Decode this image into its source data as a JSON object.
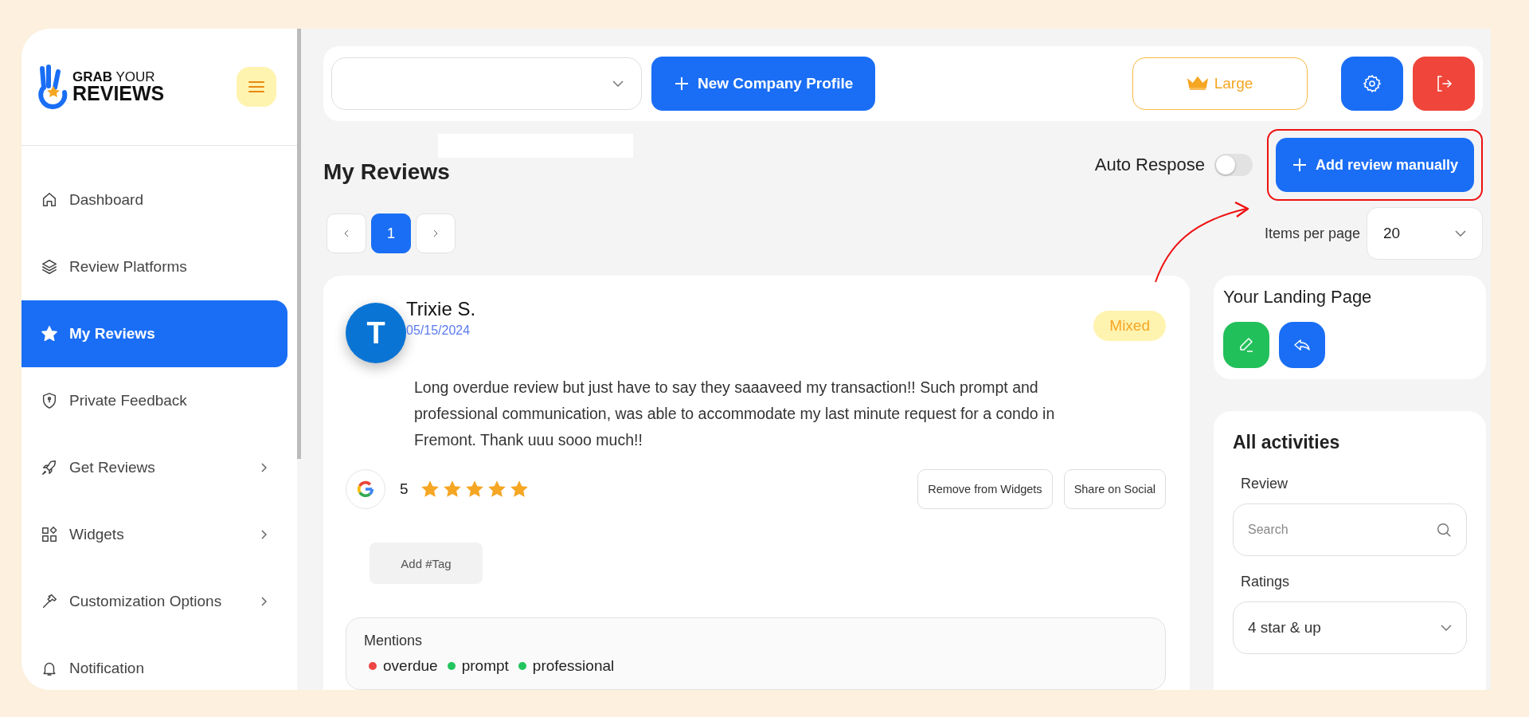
{
  "logo": {
    "line_1": "**GRAB** YOUR",
    "line_2": "REVIEWS"
  },
  "sidebar": {
    "items": [
      {
        "label": "Dashboard",
        "kind": "home",
        "selected": false,
        "expandable": false
      },
      {
        "label": "Review Platforms",
        "kind": "layers",
        "selected": false,
        "expandable": false
      },
      {
        "label": "My Reviews",
        "kind": "star",
        "selected": true,
        "expandable": false
      },
      {
        "label": "Private Feedback",
        "kind": "shield",
        "selected": false,
        "expandable": false
      },
      {
        "label": "Get Reviews",
        "kind": "rocket",
        "selected": false,
        "expandable": true
      },
      {
        "label": "Widgets",
        "kind": "grid",
        "selected": false,
        "expandable": true
      },
      {
        "label": "Customization Options",
        "kind": "hammer",
        "selected": false,
        "expandable": true
      },
      {
        "label": "Notification",
        "kind": "bell",
        "selected": false,
        "expandable": false
      }
    ]
  },
  "top_bar": {
    "new_profile_button": "New Company Profile",
    "plan_button": "Large"
  },
  "page_title": "My Reviews",
  "auto_response": {
    "label": "Auto Respose",
    "on": false
  },
  "add_button": "Add review manually",
  "pagination": {
    "pages": [
      {
        "label": "1",
        "selected": true
      }
    ]
  },
  "items_per_page": {
    "label": "Items per page",
    "value": "20"
  },
  "review": {
    "avatar_letter": "T",
    "name": "Trixie S.",
    "date": "05/15/2024",
    "sentiment": "Mixed",
    "text": "Long overdue review but just have to say they saaaveed my transaction!! Such prompt and professional communication, was able to accommodate my last minute request for a condo in Fremont. Thank uuu sooo much!!",
    "rating": "5",
    "stars": 5,
    "actions": [
      "Remove from Widgets",
      "Share on Social"
    ],
    "tag_button": "Add #Tag",
    "mentions": {
      "title": "Mentions",
      "items": [
        {
          "label": "overdue",
          "color": "#ef4444"
        },
        {
          "label": "prompt",
          "color": "#22c55e"
        },
        {
          "label": "professional",
          "color": "#22c55e"
        }
      ]
    }
  },
  "landing_page": {
    "title": "Your Landing Page"
  },
  "activities": {
    "title": "All activities",
    "review_label": "Review",
    "search_placeholder": "Search",
    "ratings_label": "Ratings",
    "ratings_value": "4 star & up"
  }
}
